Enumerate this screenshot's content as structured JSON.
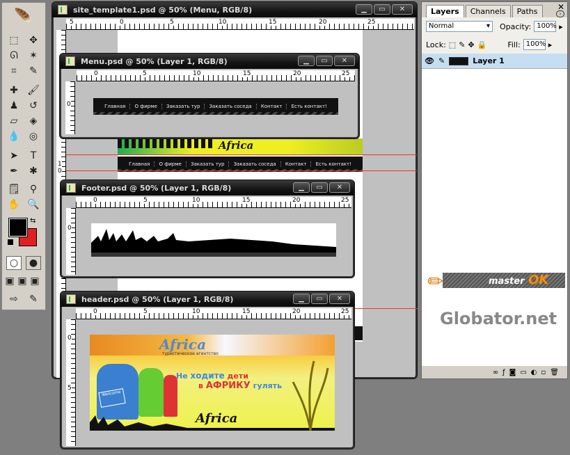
{
  "windows": {
    "site_template": {
      "title": "site_template1.psd @ 50% (Menu, RGB/8)"
    },
    "menu": {
      "title": "Menu.psd @ 50% (Layer 1, RGB/8)"
    },
    "footer": {
      "title": "Footer.psd @ 50% (Layer 1, RGB/8)"
    },
    "header": {
      "title": "header.psd @ 50% (Layer 1, RGB/8)"
    }
  },
  "window_buttons": {
    "minimize": "▁",
    "maximize": "▭",
    "close": "✕"
  },
  "rulers": {
    "h": [
      "5",
      "0",
      "5",
      "10",
      "15",
      "20",
      "25"
    ],
    "menu_h": [
      "0",
      "5",
      "10",
      "15",
      "20",
      "25"
    ],
    "v_menu": [
      "0"
    ],
    "v_site": [
      "1",
      "0"
    ],
    "v_header": [
      "0",
      "5"
    ]
  },
  "nav_items": [
    "Главная",
    "О фирме",
    "Заказать тур",
    "Заказать соседа",
    "Контакт",
    "Есть контакт!"
  ],
  "site_banner_text": "Africa",
  "header_banner": {
    "logo": "Africa",
    "subtitle": "туристическое агентство",
    "line1_a": "Не",
    "line1_b": "ходите",
    "line1_c": "дети",
    "line2_a": "в",
    "line2_b": "АФРИКУ",
    "line2_c": "гулять",
    "script": "Africa",
    "sign": "Welcome"
  },
  "layers_panel": {
    "tabs": [
      "Layers",
      "Channels",
      "Paths"
    ],
    "blend_mode": "Normal",
    "opacity_label": "Opacity:",
    "opacity": "100%",
    "lock_label": "Lock:",
    "fill_label": "Fill:",
    "fill": "100%",
    "layer_name": "Layer 1"
  },
  "watermark": {
    "brand_a": "master",
    "brand_b": "OK",
    "site": "Globator.net"
  },
  "colors": {
    "fg_swatch": "#000000",
    "bg_swatch": "#e02020",
    "layer_selected": "#c6def2",
    "guide": "#e33333"
  }
}
